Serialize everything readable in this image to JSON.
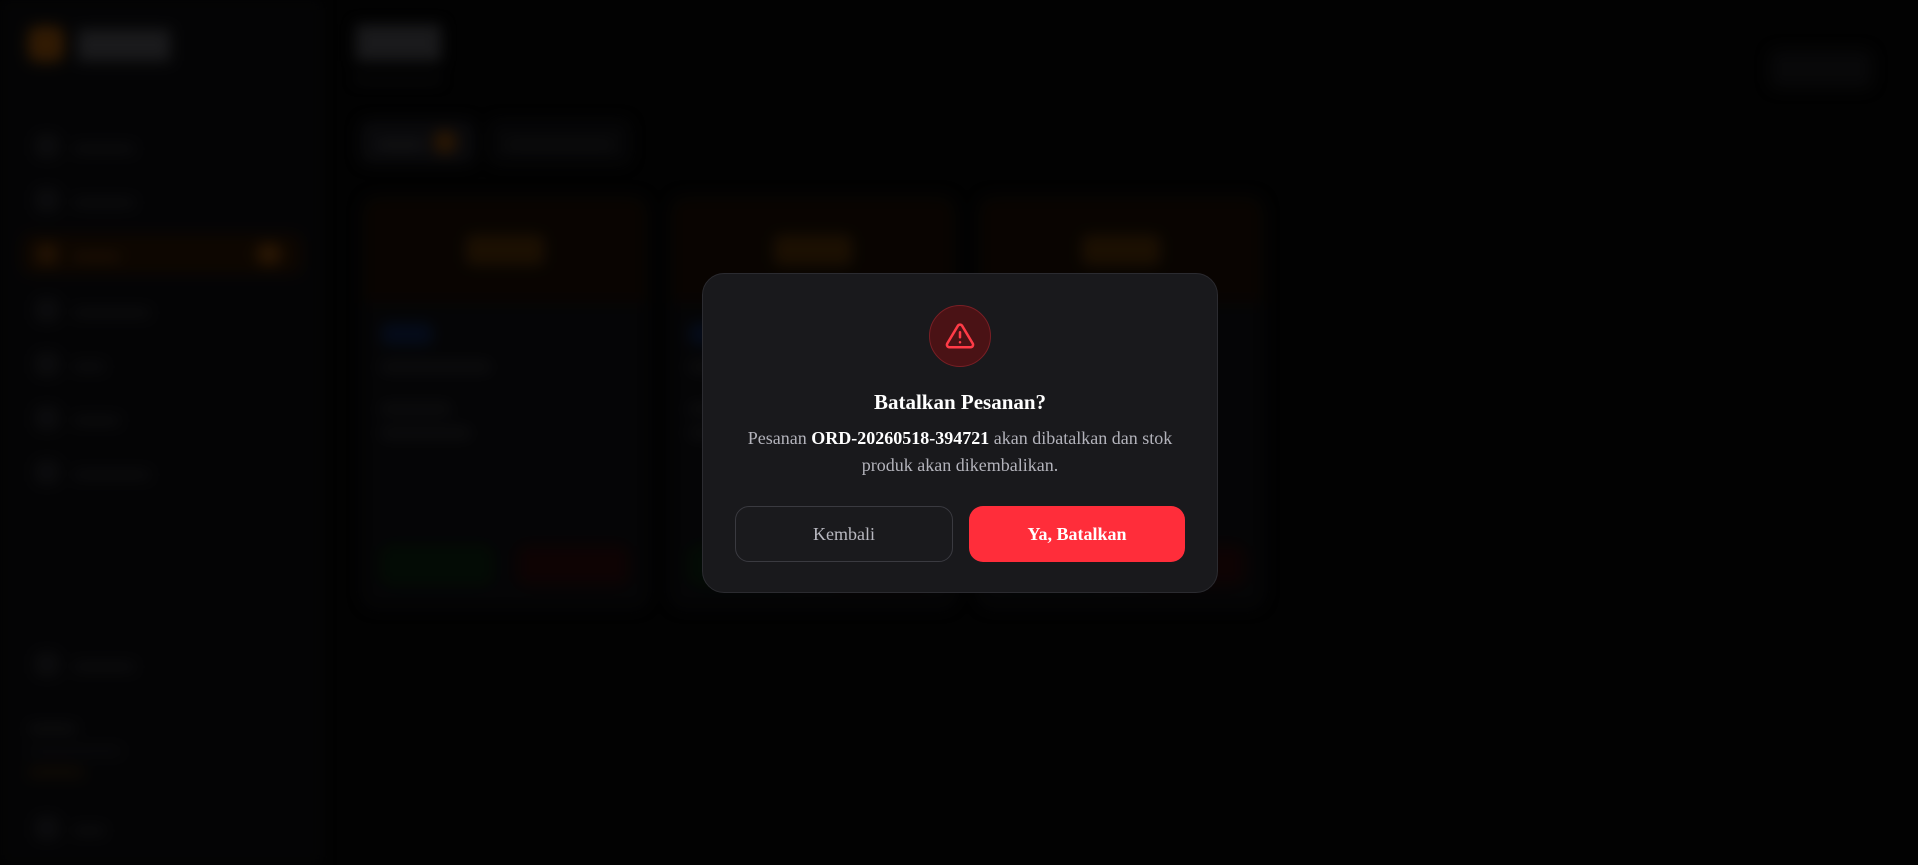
{
  "colors": {
    "accent": "#f59e0b",
    "danger": "#ff2d3a",
    "modal_bg": "#19191c",
    "text_primary": "#ffffff",
    "text_muted": "#b3b3bb"
  },
  "modal": {
    "icon": "warning-triangle-icon",
    "title": "Batalkan Pesanan?",
    "message_prefix": "Pesanan ",
    "order_id": "ORD-20260518-394721",
    "message_suffix": " akan dibatalkan dan stok produk akan dikembalikan.",
    "back_label": "Kembali",
    "confirm_label": "Ya, Batalkan"
  }
}
